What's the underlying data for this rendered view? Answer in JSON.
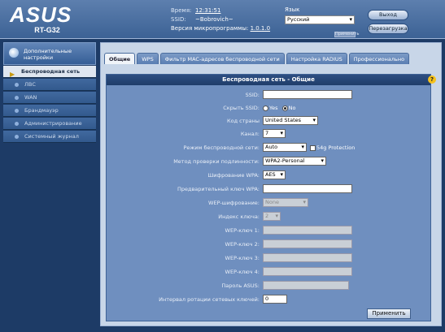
{
  "header": {
    "brand": "ASUS",
    "model": "RT-G32",
    "time_label": "Время:",
    "time_value": "12:31:51",
    "ssid_label": "SSID:",
    "ssid_value": "~Bobrovich~",
    "firmware_label": "Версия микропрограммы:",
    "firmware_value": "1.0.1.0",
    "lang_label": "Язык",
    "lang_value": "Русский",
    "lang_apply": "Применить",
    "logout": "Выход",
    "reboot": "Перезагрузка"
  },
  "sidebar": {
    "advanced_label": "Дополнительные настройки",
    "items": [
      {
        "label": "Беспроводная сеть",
        "active": true
      },
      {
        "label": "ЛВС",
        "active": false
      },
      {
        "label": "WAN",
        "active": false
      },
      {
        "label": "Брандмауэр",
        "active": false
      },
      {
        "label": "Администрирование",
        "active": false
      },
      {
        "label": "Системный журнал",
        "active": false
      }
    ]
  },
  "tabs": [
    "Общие",
    "WPS",
    "Фильтр MAC-адресов беспроводной сети",
    "Настройка RADIUS",
    "Профессионально"
  ],
  "panel": {
    "title": "Беспроводная сеть - Общие",
    "fields": {
      "ssid": {
        "label": "SSID:",
        "value": ""
      },
      "hide_ssid": {
        "label": "Скрыть SSID:",
        "yes": "Yes",
        "no": "No",
        "selected": "No"
      },
      "country": {
        "label": "Код страны",
        "value": "United States"
      },
      "channel": {
        "label": "Канал:",
        "value": "7"
      },
      "mode": {
        "label": "Режим беспроводной сети:",
        "value": "Auto",
        "checkbox": "54g Protection"
      },
      "auth": {
        "label": "Метод проверки подлинности:",
        "value": "WPA2-Personal"
      },
      "wpa_enc": {
        "label": "Шифрование WPA:",
        "value": "AES"
      },
      "wpa_key": {
        "label": "Предварительный ключ WPA:",
        "value": ""
      },
      "wep_enc": {
        "label": "WEP-шифрование:",
        "value": "None"
      },
      "key_index": {
        "label": "Индекс ключа:",
        "value": "2"
      },
      "wep1": {
        "label": "WEP-ключ 1:",
        "value": ""
      },
      "wep2": {
        "label": "WEP-ключ 2:",
        "value": ""
      },
      "wep3": {
        "label": "WEP-ключ 3:",
        "value": ""
      },
      "wep4": {
        "label": "WEP-ключ 4:",
        "value": ""
      },
      "passphrase": {
        "label": "Пароль ASUS:",
        "value": ""
      },
      "rotation": {
        "label": "Интервал ротации сетевых ключей:",
        "value": "0"
      }
    },
    "apply": "Применить"
  },
  "colors": {
    "accent": "#3c6295",
    "panel": "#6f8fbf",
    "help": "#f6c21b"
  }
}
